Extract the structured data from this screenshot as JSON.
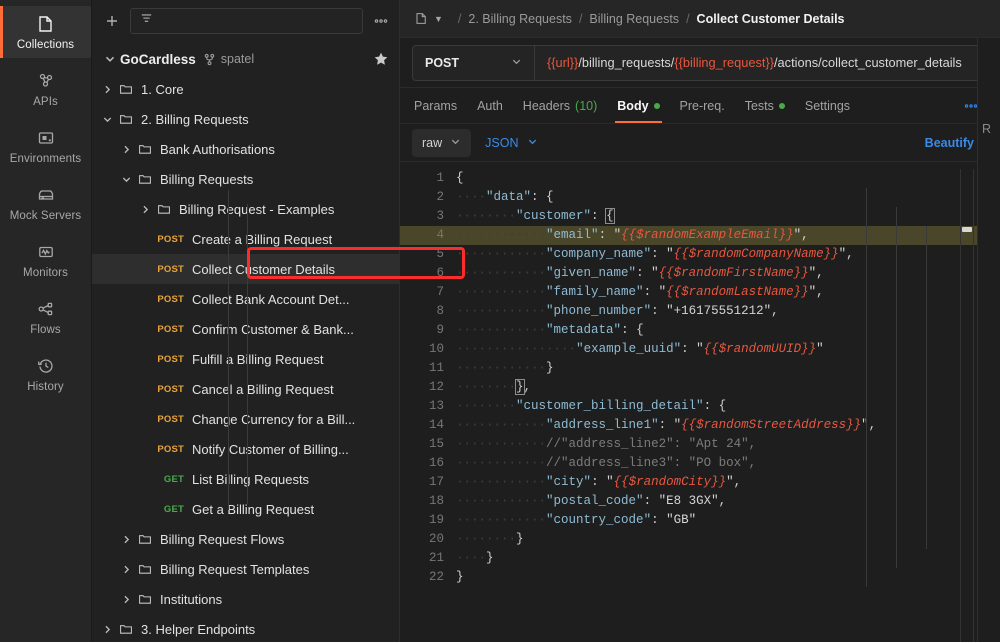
{
  "rail": {
    "items": [
      {
        "label": "Collections",
        "icon": "collections-icon",
        "active": true
      },
      {
        "label": "APIs",
        "icon": "apis-icon",
        "active": false
      },
      {
        "label": "Environments",
        "icon": "environments-icon",
        "active": false
      },
      {
        "label": "Mock Servers",
        "icon": "mock-servers-icon",
        "active": false
      },
      {
        "label": "Monitors",
        "icon": "monitors-icon",
        "active": false
      },
      {
        "label": "Flows",
        "icon": "flows-icon",
        "active": false
      },
      {
        "label": "History",
        "icon": "history-icon",
        "active": false
      }
    ]
  },
  "sidebar": {
    "toolbar": {
      "new_label": "+",
      "filter_placeholder": "",
      "filter_icon": "filter-icon",
      "more_icon": "more-horizontal-icon"
    },
    "collection": {
      "name": "GoCardless",
      "fork_icon": "fork-icon",
      "user": "spatel",
      "star_icon": "star-icon",
      "expanded": true
    },
    "tree": [
      {
        "type": "folder",
        "label": "1. Core",
        "depth": 1,
        "expanded": false
      },
      {
        "type": "folder",
        "label": "2. Billing Requests",
        "depth": 1,
        "expanded": true
      },
      {
        "type": "folder",
        "label": "Bank Authorisations",
        "depth": 2,
        "expanded": false
      },
      {
        "type": "folder",
        "label": "Billing Requests",
        "depth": 2,
        "expanded": true
      },
      {
        "type": "folder",
        "label": "Billing Request - Examples",
        "depth": 3,
        "expanded": false
      },
      {
        "type": "request",
        "method": "POST",
        "label": "Create a Billing Request",
        "depth": 3
      },
      {
        "type": "request",
        "method": "POST",
        "label": "Collect Customer Details",
        "depth": 3,
        "selected": true,
        "annotated": true
      },
      {
        "type": "request",
        "method": "POST",
        "label": "Collect Bank Account Det...",
        "depth": 3
      },
      {
        "type": "request",
        "method": "POST",
        "label": "Confirm Customer & Bank...",
        "depth": 3
      },
      {
        "type": "request",
        "method": "POST",
        "label": "Fulfill a Billing Request",
        "depth": 3
      },
      {
        "type": "request",
        "method": "POST",
        "label": "Cancel a Billing Request",
        "depth": 3
      },
      {
        "type": "request",
        "method": "POST",
        "label": "Change Currency for a Bill...",
        "depth": 3
      },
      {
        "type": "request",
        "method": "POST",
        "label": "Notify Customer of Billing...",
        "depth": 3
      },
      {
        "type": "request",
        "method": "GET",
        "label": "List Billing Requests",
        "depth": 3
      },
      {
        "type": "request",
        "method": "GET",
        "label": "Get a Billing Request",
        "depth": 3
      },
      {
        "type": "folder",
        "label": "Billing Request Flows",
        "depth": 2,
        "expanded": false
      },
      {
        "type": "folder",
        "label": "Billing Request Templates",
        "depth": 2,
        "expanded": false
      },
      {
        "type": "folder",
        "label": "Institutions",
        "depth": 2,
        "expanded": false
      },
      {
        "type": "folder",
        "label": "3. Helper Endpoints",
        "depth": 1,
        "expanded": false
      }
    ]
  },
  "breadcrumb": {
    "collection_icon": "collection-icon",
    "caret_icon": "chevron-down-icon",
    "items": [
      "2. Billing Requests",
      "Billing Requests"
    ],
    "current": "Collect Customer Details",
    "separator": "/"
  },
  "request": {
    "method": "POST",
    "url_parts": [
      {
        "text": "{{url}}",
        "variable": true
      },
      {
        "text": "/billing_requests/",
        "variable": false
      },
      {
        "text": "{{billing_request}}",
        "variable": true
      },
      {
        "text": "/actions/collect_customer_details",
        "variable": false
      }
    ],
    "url_full": "{{url}}/billing_requests/{{billing_request}}/actions/collect_customer_details"
  },
  "tabs": [
    {
      "label": "Params",
      "active": false
    },
    {
      "label": "Auth",
      "active": false
    },
    {
      "label": "Headers",
      "count": "(10)",
      "active": false
    },
    {
      "label": "Body",
      "active": true,
      "dot": true
    },
    {
      "label": "Pre-req.",
      "active": false
    },
    {
      "label": "Tests",
      "active": false,
      "dot": true
    },
    {
      "label": "Settings",
      "active": false
    }
  ],
  "tabs_more_icon": "more-horizontal-icon",
  "body_toolbar": {
    "mode": "raw",
    "mode_caret": "chevron-down-icon",
    "language": "JSON",
    "language_caret": "chevron-down-icon",
    "beautify_label": "Beautify"
  },
  "editor": {
    "highlighted_line": 4,
    "lines": [
      {
        "n": 1,
        "tokens": [
          {
            "t": "{",
            "c": "pun"
          }
        ]
      },
      {
        "n": 2,
        "tokens": [
          {
            "t": "····",
            "c": "ind"
          },
          {
            "t": "\"data\"",
            "c": "key"
          },
          {
            "t": ": {",
            "c": "pun"
          }
        ]
      },
      {
        "n": 3,
        "tokens": [
          {
            "t": "····",
            "c": "ind"
          },
          {
            "t": "····",
            "c": "ind"
          },
          {
            "t": "\"customer\"",
            "c": "key"
          },
          {
            "t": ": ",
            "c": "pun"
          },
          {
            "t": "{",
            "c": "brk"
          }
        ]
      },
      {
        "n": 4,
        "tokens": [
          {
            "t": "····",
            "c": "ind"
          },
          {
            "t": "····",
            "c": "ind"
          },
          {
            "t": "····",
            "c": "ind"
          },
          {
            "t": "\"email\"",
            "c": "key"
          },
          {
            "t": ": ",
            "c": "pun"
          },
          {
            "t": "\"",
            "c": "str"
          },
          {
            "t": "{{$randomExampleEmail}}",
            "c": "var"
          },
          {
            "t": "\",",
            "c": "str"
          }
        ]
      },
      {
        "n": 5,
        "tokens": [
          {
            "t": "····",
            "c": "ind"
          },
          {
            "t": "····",
            "c": "ind"
          },
          {
            "t": "····",
            "c": "ind"
          },
          {
            "t": "\"company_name\"",
            "c": "key"
          },
          {
            "t": ": ",
            "c": "pun"
          },
          {
            "t": "\"",
            "c": "str"
          },
          {
            "t": "{{$randomCompanyName}}",
            "c": "var"
          },
          {
            "t": "\",",
            "c": "str"
          }
        ]
      },
      {
        "n": 6,
        "tokens": [
          {
            "t": "····",
            "c": "ind"
          },
          {
            "t": "····",
            "c": "ind"
          },
          {
            "t": "····",
            "c": "ind"
          },
          {
            "t": "\"given_name\"",
            "c": "key"
          },
          {
            "t": ": ",
            "c": "pun"
          },
          {
            "t": "\"",
            "c": "str"
          },
          {
            "t": "{{$randomFirstName}}",
            "c": "var"
          },
          {
            "t": "\",",
            "c": "str"
          }
        ]
      },
      {
        "n": 7,
        "tokens": [
          {
            "t": "····",
            "c": "ind"
          },
          {
            "t": "····",
            "c": "ind"
          },
          {
            "t": "····",
            "c": "ind"
          },
          {
            "t": "\"family_name\"",
            "c": "key"
          },
          {
            "t": ": ",
            "c": "pun"
          },
          {
            "t": "\"",
            "c": "str"
          },
          {
            "t": "{{$randomLastName}}",
            "c": "var"
          },
          {
            "t": "\",",
            "c": "str"
          }
        ]
      },
      {
        "n": 8,
        "tokens": [
          {
            "t": "····",
            "c": "ind"
          },
          {
            "t": "····",
            "c": "ind"
          },
          {
            "t": "····",
            "c": "ind"
          },
          {
            "t": "\"phone_number\"",
            "c": "key"
          },
          {
            "t": ": ",
            "c": "pun"
          },
          {
            "t": "\"+16175551212\",",
            "c": "str"
          }
        ]
      },
      {
        "n": 9,
        "tokens": [
          {
            "t": "····",
            "c": "ind"
          },
          {
            "t": "····",
            "c": "ind"
          },
          {
            "t": "····",
            "c": "ind"
          },
          {
            "t": "\"metadata\"",
            "c": "key"
          },
          {
            "t": ": {",
            "c": "pun"
          }
        ]
      },
      {
        "n": 10,
        "tokens": [
          {
            "t": "····",
            "c": "ind"
          },
          {
            "t": "····",
            "c": "ind"
          },
          {
            "t": "····",
            "c": "ind"
          },
          {
            "t": "····",
            "c": "ind"
          },
          {
            "t": "\"example_uuid\"",
            "c": "key"
          },
          {
            "t": ": ",
            "c": "pun"
          },
          {
            "t": "\"",
            "c": "str"
          },
          {
            "t": "{{$randomUUID}}",
            "c": "var"
          },
          {
            "t": "\"",
            "c": "str"
          }
        ]
      },
      {
        "n": 11,
        "tokens": [
          {
            "t": "····",
            "c": "ind"
          },
          {
            "t": "····",
            "c": "ind"
          },
          {
            "t": "····",
            "c": "ind"
          },
          {
            "t": "}",
            "c": "pun"
          }
        ]
      },
      {
        "n": 12,
        "tokens": [
          {
            "t": "····",
            "c": "ind"
          },
          {
            "t": "····",
            "c": "ind"
          },
          {
            "t": "}",
            "c": "brk"
          },
          {
            "t": ",",
            "c": "pun"
          }
        ]
      },
      {
        "n": 13,
        "tokens": [
          {
            "t": "····",
            "c": "ind"
          },
          {
            "t": "····",
            "c": "ind"
          },
          {
            "t": "\"customer_billing_detail\"",
            "c": "key"
          },
          {
            "t": ": {",
            "c": "pun"
          }
        ]
      },
      {
        "n": 14,
        "tokens": [
          {
            "t": "····",
            "c": "ind"
          },
          {
            "t": "····",
            "c": "ind"
          },
          {
            "t": "····",
            "c": "ind"
          },
          {
            "t": "\"address_line1\"",
            "c": "key"
          },
          {
            "t": ": ",
            "c": "pun"
          },
          {
            "t": "\"",
            "c": "str"
          },
          {
            "t": "{{$randomStreetAddress}}",
            "c": "var"
          },
          {
            "t": "\",",
            "c": "str"
          }
        ]
      },
      {
        "n": 15,
        "tokens": [
          {
            "t": "····",
            "c": "ind"
          },
          {
            "t": "····",
            "c": "ind"
          },
          {
            "t": "····",
            "c": "ind"
          },
          {
            "t": "//\"address_line2\": \"Apt 24\",",
            "c": "com"
          }
        ]
      },
      {
        "n": 16,
        "tokens": [
          {
            "t": "····",
            "c": "ind"
          },
          {
            "t": "····",
            "c": "ind"
          },
          {
            "t": "····",
            "c": "ind"
          },
          {
            "t": "//\"address_line3\": \"PO box\",",
            "c": "com"
          }
        ]
      },
      {
        "n": 17,
        "tokens": [
          {
            "t": "····",
            "c": "ind"
          },
          {
            "t": "····",
            "c": "ind"
          },
          {
            "t": "····",
            "c": "ind"
          },
          {
            "t": "\"city\"",
            "c": "key"
          },
          {
            "t": ": ",
            "c": "pun"
          },
          {
            "t": "\"",
            "c": "str"
          },
          {
            "t": "{{$randomCity}}",
            "c": "var"
          },
          {
            "t": "\",",
            "c": "str"
          }
        ]
      },
      {
        "n": 18,
        "tokens": [
          {
            "t": "····",
            "c": "ind"
          },
          {
            "t": "····",
            "c": "ind"
          },
          {
            "t": "····",
            "c": "ind"
          },
          {
            "t": "\"postal_code\"",
            "c": "key"
          },
          {
            "t": ": ",
            "c": "pun"
          },
          {
            "t": "\"E8 3GX\",",
            "c": "str"
          }
        ]
      },
      {
        "n": 19,
        "tokens": [
          {
            "t": "····",
            "c": "ind"
          },
          {
            "t": "····",
            "c": "ind"
          },
          {
            "t": "····",
            "c": "ind"
          },
          {
            "t": "\"country_code\"",
            "c": "key"
          },
          {
            "t": ": ",
            "c": "pun"
          },
          {
            "t": "\"GB\"",
            "c": "str"
          }
        ]
      },
      {
        "n": 20,
        "tokens": [
          {
            "t": "····",
            "c": "ind"
          },
          {
            "t": "····",
            "c": "ind"
          },
          {
            "t": "}",
            "c": "pun"
          }
        ]
      },
      {
        "n": 21,
        "tokens": [
          {
            "t": "····",
            "c": "ind"
          },
          {
            "t": "}",
            "c": "pun"
          }
        ]
      },
      {
        "n": 22,
        "tokens": [
          {
            "t": "}",
            "c": "pun"
          }
        ]
      }
    ]
  },
  "response_panel": {
    "label": "R"
  },
  "colors": {
    "accent_orange": "#ff6c37",
    "method_post": "#e8a33d",
    "method_get": "#4aa94a",
    "variable": "#e8573f",
    "link_blue": "#3b8ae8",
    "annotation_red": "#fb2c2c",
    "highlight_line": "#4a462a",
    "json_key": "#8fbcd4",
    "comment": "#7c7c7c"
  }
}
